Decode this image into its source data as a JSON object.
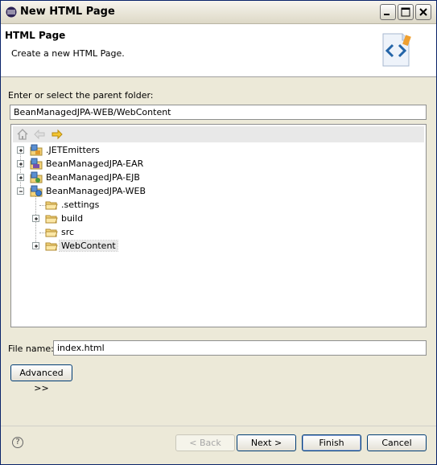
{
  "window": {
    "title": "New HTML Page"
  },
  "header": {
    "title": "HTML Page",
    "description": "Create a new HTML Page."
  },
  "parent_folder": {
    "label": "Enter or select the parent folder:",
    "value": "BeanManagedJPA-WEB/WebContent"
  },
  "tree": {
    "toolbar": {
      "home": "home-icon",
      "back": "back-arrow-icon",
      "forward": "forward-arrow-icon"
    },
    "items": [
      {
        "label": ".JETEmitters",
        "icon": "project-icon",
        "expander": "plus"
      },
      {
        "label": "BeanManagedJPA-EAR",
        "icon": "project-icon",
        "expander": "plus"
      },
      {
        "label": "BeanManagedJPA-EJB",
        "icon": "project-icon",
        "expander": "plus"
      },
      {
        "label": "BeanManagedJPA-WEB",
        "icon": "project-icon",
        "expander": "minus"
      },
      {
        "label": ".settings",
        "icon": "folder-icon",
        "expander": "none"
      },
      {
        "label": "build",
        "icon": "folder-icon",
        "expander": "plus"
      },
      {
        "label": "src",
        "icon": "folder-icon",
        "expander": "none"
      },
      {
        "label": "WebContent",
        "icon": "folder-icon",
        "expander": "plus",
        "selected": true
      }
    ]
  },
  "file_name": {
    "label": "File name:",
    "value": "index.html"
  },
  "buttons": {
    "advanced": "Advanced >>",
    "back": "< Back",
    "next": "Next >",
    "finish": "Finish",
    "cancel": "Cancel",
    "help": "?"
  },
  "colors": {
    "selection": "#e8e8e8",
    "title_bar": "#ece9d8"
  }
}
